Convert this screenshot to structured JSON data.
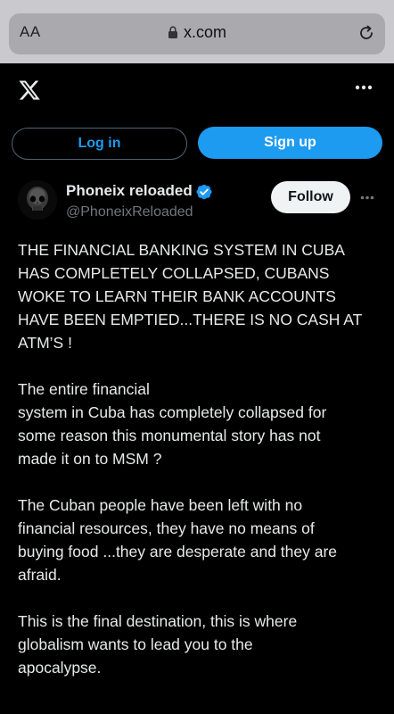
{
  "browser": {
    "aa_label": "AA",
    "url": "x.com"
  },
  "auth": {
    "login_label": "Log in",
    "signup_label": "Sign up"
  },
  "post": {
    "display_name": "Phoneix reloaded",
    "handle": "@PhoneixReloaded",
    "follow_label": "Follow",
    "paragraphs": [
      "THE FINANCIAL BANKING SYSTEM IN CUBA\nHAS COMPLETELY COLLAPSED, CUBANS\nWOKE TO LEARN THEIR BANK ACCOUNTS\nHAVE BEEN EMPTIED...THERE IS NO CASH AT\nATM’S !",
      "The entire financial\nsystem in Cuba has completely collapsed for\nsome reason this monumental story has not\nmade it on to MSM ?",
      "The Cuban people have been left with no\nfinancial resources, they have no means of\nbuying food ...they are desperate and they are\nafraid.",
      "This is the final destination, this is where\nglobalism wants to lead you to the\napocalypse."
    ]
  },
  "colors": {
    "background": "#000000",
    "text": "#e7e9ea",
    "muted": "#71767b",
    "accent": "#1d9bf0"
  },
  "icons": {
    "lock": "lock-icon",
    "reload": "reload-icon",
    "logo": "x-logo-icon",
    "more": "more-icon",
    "verified": "verified-badge-icon",
    "avatar": "skull-avatar"
  }
}
